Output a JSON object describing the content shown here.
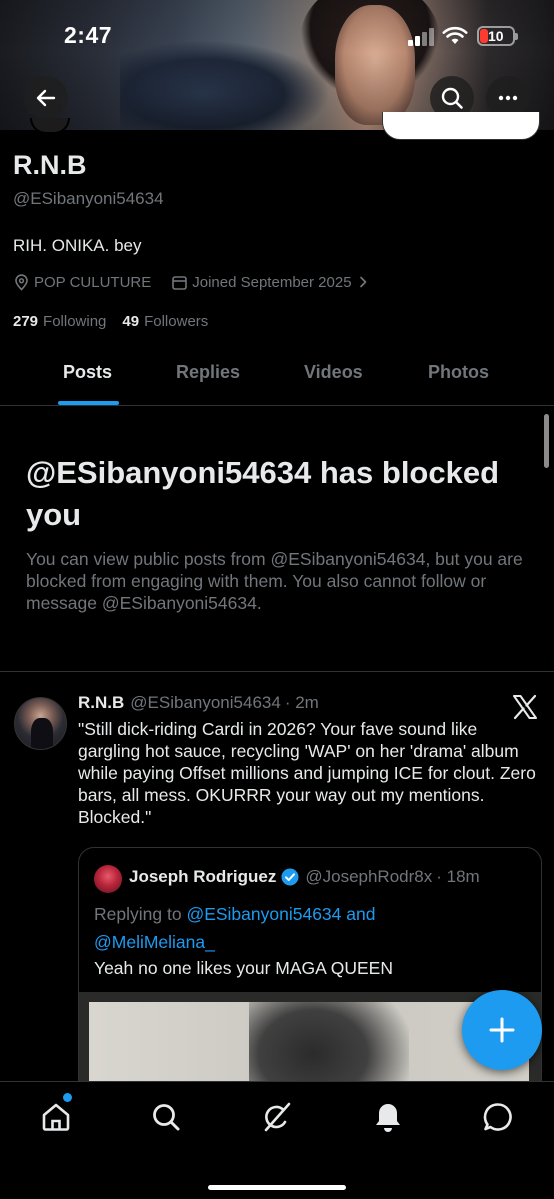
{
  "status_bar": {
    "time": "2:47",
    "battery": "10"
  },
  "profile": {
    "display_name": "R.N.B",
    "handle": "@ESibanyoni54634",
    "bio": "RIH. ONIKA. bey",
    "location": "POP CULUTURE",
    "joined": "Joined September 2025",
    "following_count": "279",
    "following_label": "Following",
    "followers_count": "49",
    "followers_label": "Followers"
  },
  "tabs": [
    {
      "label": "Posts",
      "active": true
    },
    {
      "label": "Replies",
      "active": false
    },
    {
      "label": "Videos",
      "active": false
    },
    {
      "label": "Photos",
      "active": false
    }
  ],
  "blocked_notice": {
    "title": "@ESibanyoni54634 has blocked you",
    "body": "You can view public posts from @ESibanyoni54634, but you are blocked from engaging with them. You also cannot follow or message @ESibanyoni54634."
  },
  "post": {
    "author_name": "R.N.B",
    "author_handle": "@ESibanyoni54634",
    "time": "· 2m",
    "text": "\"Still dick-riding Cardi in 2026? Your fave sound like gargling hot sauce, recycling 'WAP' on her 'drama' album while paying Offset millions and jumping ICE for clout. Zero bars, all mess. OKURRR your way out my mentions. Blocked.\"",
    "quote": {
      "author_name": "Joseph Rodriguez",
      "author_handle": "@JosephRodr8x",
      "time": "· 18m",
      "replying_prefix": "Replying to",
      "replying_mention_1": "@ESibanyoni54634",
      "replying_and": " and",
      "replying_mention_2": "@MeliMeliana_",
      "text": "Yeah no one likes your MAGA QUEEN"
    }
  },
  "colors": {
    "accent": "#1d9bf0",
    "muted": "#71767b",
    "text": "#e7e9ea",
    "background": "#000000"
  },
  "icons": {
    "back": "back-arrow-icon",
    "search": "search-icon",
    "more": "more-icon",
    "location": "location-pin-icon",
    "calendar": "calendar-icon",
    "chevron": "chevron-right-icon",
    "x_logo": "x-logo-icon",
    "verified": "verified-badge-icon",
    "compose": "plus-icon",
    "nav": [
      "home-icon",
      "search-icon",
      "grok-icon",
      "bell-icon",
      "chat-icon"
    ]
  }
}
